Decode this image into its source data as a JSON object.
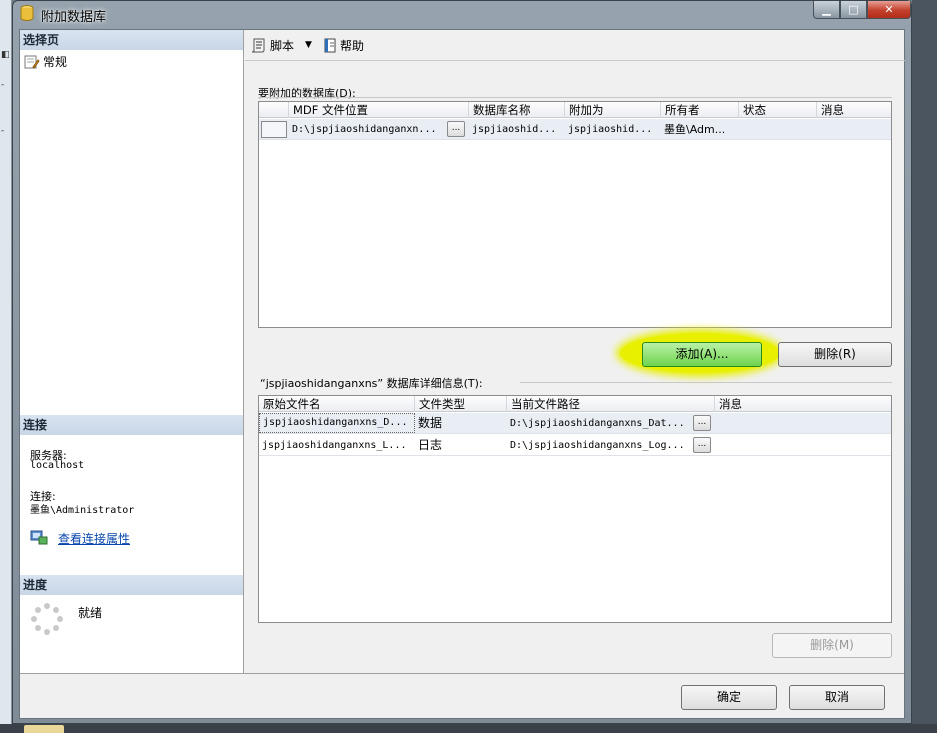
{
  "window": {
    "title": "附加数据库"
  },
  "toolbar": {
    "script_label": "脚本",
    "help_label": "帮助"
  },
  "left": {
    "select_page_header": "选择页",
    "pages": [
      {
        "label": "常规"
      }
    ],
    "connection_header": "连接",
    "server_label": "服务器:",
    "server_value": "localhost",
    "connection_label": "连接:",
    "connection_value": "墨鱼\\Administrator",
    "view_connection_link": "查看连接属性",
    "progress_header": "进度",
    "progress_status": "就绪"
  },
  "attach_grid": {
    "label": "要附加的数据库(D):",
    "columns": [
      "MDF 文件位置",
      "数据库名称",
      "附加为",
      "所有者",
      "状态",
      "消息"
    ],
    "rows": [
      {
        "mdf": "D:\\jspjiaoshidanganxn...",
        "db_name": "jspjiaoshid...",
        "attach_as": "jspjiaoshid...",
        "owner": "墨鱼\\Adm...",
        "status": "",
        "message": ""
      }
    ],
    "ellipsis": "..."
  },
  "buttons": {
    "add": "添加(A)...",
    "remove_top": "删除(R)",
    "remove_bottom": "删除(M)",
    "ok": "确定",
    "cancel": "取消"
  },
  "details_grid": {
    "label": "“jspjiaoshidanganxns” 数据库详细信息(T):",
    "columns": [
      "原始文件名",
      "文件类型",
      "当前文件路径",
      "消息"
    ],
    "rows": [
      {
        "original": "jspjiaoshidanganxns_D...",
        "type": "数据",
        "path": "D:\\jspjiaoshidanganxns_Dat...",
        "message": ""
      },
      {
        "original": "jspjiaoshidanganxns_L...",
        "type": "日志",
        "path": "D:\\jspjiaoshidanganxns_Log...",
        "message": ""
      }
    ],
    "ellipsis": "..."
  },
  "colors": {
    "highlight": "#e8f000",
    "link": "#0645ad",
    "close": "#c2402c"
  }
}
